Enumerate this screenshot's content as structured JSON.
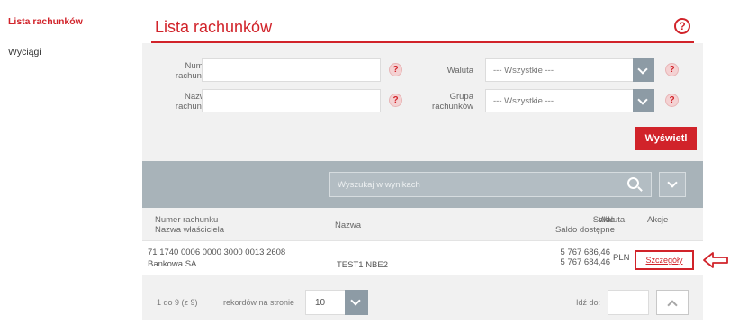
{
  "sidebar": {
    "items": [
      {
        "label": "Lista rachunków",
        "active": true
      },
      {
        "label": "Wyciągi",
        "active": false
      }
    ]
  },
  "header": {
    "title": "Lista rachunków"
  },
  "filters": {
    "account_number_label": "Numer\nrachunku",
    "account_name_label": "Nazwa\nrachunku",
    "currency_label": "Waluta",
    "currency_value": "--- Wszystkie ---",
    "group_label": "Grupa\nrachunków",
    "group_value": "--- Wszystkie ---",
    "help_glyph": "?"
  },
  "show_button": "Wyświetl",
  "search": {
    "placeholder": "Wyszukaj w wynikach"
  },
  "table": {
    "columns": {
      "account_number": "Numer rachunku",
      "owner": "Nazwa właściciela",
      "name": "Nazwa",
      "balance": "Saldo",
      "available": "Saldo dostępne",
      "currency": "Waluta",
      "actions": "Akcje"
    },
    "rows": [
      {
        "account_number": "71 1740 0006 0000 3000 0013 2608",
        "owner": "Bankowa SA",
        "name": "TEST1 NBE2",
        "balance": "5 767 686,46",
        "available": "5 767 684,46",
        "currency": "PLN",
        "action": "Szczegóły"
      }
    ]
  },
  "pagination": {
    "range": "1 do 9 (z 9)",
    "per_page_label": "rekordów na stronie",
    "per_page_value": "10",
    "goto_label": "Idź do:"
  },
  "colors": {
    "accent": "#d1232a",
    "panel": "#f1f1f1",
    "bar": "#a8b3b9",
    "select_button": "#8d9ba5"
  },
  "icons": [
    "help-icon",
    "chevron-down-icon",
    "search-icon",
    "chevron-up-icon",
    "arrow-left-icon"
  ]
}
